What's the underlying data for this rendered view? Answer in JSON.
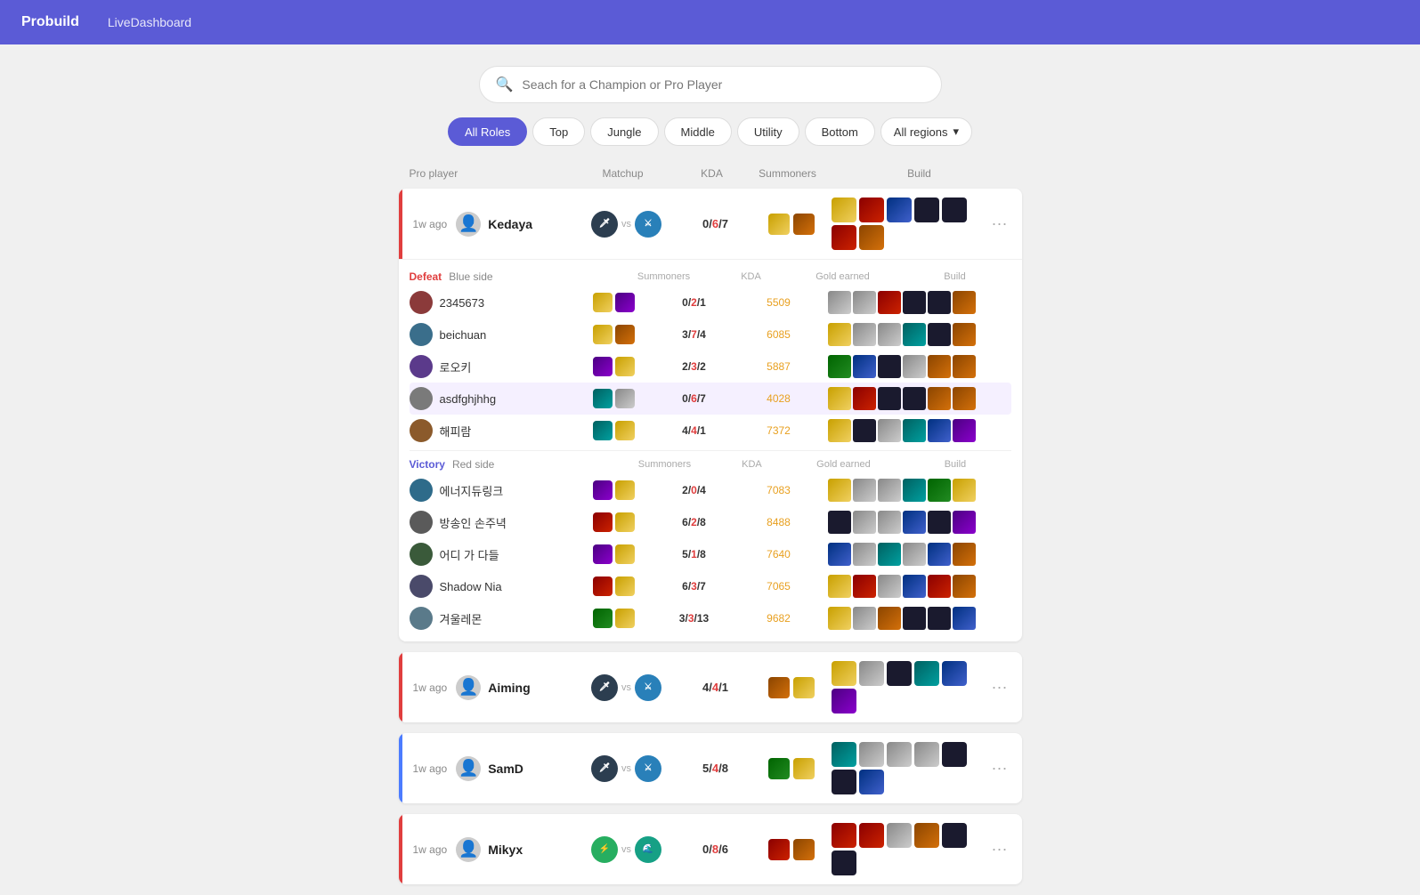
{
  "header": {
    "title": "Probuild",
    "nav": "LiveDashboard"
  },
  "search": {
    "placeholder": "Seach for a Champion or Pro Player"
  },
  "filters": {
    "roles": [
      "All Roles",
      "Top",
      "Jungle",
      "Middle",
      "Utility",
      "Bottom"
    ],
    "active_role": "All Roles",
    "region_label": "All regions"
  },
  "columns": {
    "pro_player": "Pro player",
    "matchup": "Matchup",
    "kda": "KDA",
    "summoners": "Summoners",
    "build": "Build"
  },
  "matches": [
    {
      "id": "match1",
      "time": "1w ago",
      "player": "Kedaya",
      "side_color": "red",
      "kda": {
        "kills": "0",
        "deaths": "6",
        "assists": "7"
      },
      "expanded": true,
      "defeat_team": {
        "label": "Defeat",
        "side": "Blue side",
        "players": [
          {
            "name": "2345673",
            "kda": "0/2/1",
            "kda_death_idx": 1,
            "gold": "5509"
          },
          {
            "name": "beichuan",
            "kda": "3/7/4",
            "kda_death_idx": 1,
            "gold": "6085"
          },
          {
            "name": "로오키",
            "kda": "2/3/2",
            "kda_death_idx": 1,
            "gold": "5887"
          },
          {
            "name": "asdfghjhhg",
            "kda": "0/6/7",
            "kda_death_idx": 1,
            "gold": "4028",
            "highlighted": true
          },
          {
            "name": "해피람",
            "kda": "4/4/1",
            "kda_death_idx": 1,
            "gold": "7372"
          }
        ]
      },
      "victory_team": {
        "label": "Victory",
        "side": "Red side",
        "players": [
          {
            "name": "에너지듀링크",
            "kda": "2/0/4",
            "kda_death_idx": 1,
            "gold": "7083"
          },
          {
            "name": "방송인 손주녁",
            "kda": "6/2/8",
            "kda_death_idx": 1,
            "gold": "8488"
          },
          {
            "name": "어디 가 다들",
            "kda": "5/1/8",
            "kda_death_idx": 1,
            "gold": "7640"
          },
          {
            "name": "Shadow Nia",
            "kda": "6/3/7",
            "kda_death_idx": 1,
            "gold": "7065"
          },
          {
            "name": "겨울레몬",
            "kda": "3/3/13",
            "kda_death_idx": 1,
            "gold": "9682"
          }
        ]
      }
    },
    {
      "id": "match2",
      "time": "1w ago",
      "player": "Aiming",
      "side_color": "red",
      "kda": {
        "kills": "4",
        "deaths": "4",
        "assists": "1"
      },
      "expanded": false
    },
    {
      "id": "match3",
      "time": "1w ago",
      "player": "SamD",
      "side_color": "blue",
      "kda": {
        "kills": "5",
        "deaths": "4",
        "assists": "8"
      },
      "expanded": false
    },
    {
      "id": "match4",
      "time": "1w ago",
      "player": "Mikyx",
      "side_color": "red",
      "kda": {
        "kills": "0",
        "deaths": "8",
        "assists": "6"
      },
      "expanded": false
    }
  ],
  "detail_cols": {
    "summoners": "Summoners",
    "kda": "KDA",
    "gold": "Gold earned",
    "build": "Build"
  }
}
